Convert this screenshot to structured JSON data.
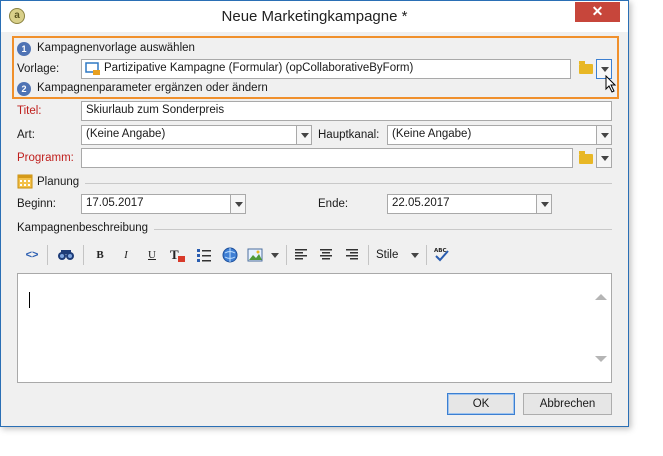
{
  "window": {
    "title": "Neue Marketingkampagne *",
    "close_glyph": "✕",
    "app_icon_glyph": "a"
  },
  "step1": {
    "number": "1",
    "label": "Kampagnenvorlage auswählen",
    "template_label": "Vorlage:",
    "template_value": "Partizipative Kampagne (Formular) (opCollaborativeByForm)"
  },
  "step2": {
    "number": "2",
    "label": "Kampagnenparameter ergänzen oder ändern"
  },
  "form": {
    "title_label": "Titel:",
    "title_value": "Skiurlaub zum Sonderpreis",
    "type_label": "Art:",
    "type_value": "(Keine Angabe)",
    "channel_label": "Hauptkanal:",
    "channel_value": "(Keine Angabe)",
    "program_label": "Programm:",
    "program_value": ""
  },
  "planning": {
    "section_label": "Planung",
    "start_label": "Beginn:",
    "start_value": "17.05.2017",
    "end_label": "Ende:",
    "end_value": "22.05.2017"
  },
  "description": {
    "section_label": "Kampagnenbeschreibung",
    "styles_label": "Stile"
  },
  "toolbar": {
    "source": "<>",
    "find": "⚲",
    "bold": "B",
    "italic": "I",
    "underline": "U",
    "spell": "ABC"
  },
  "buttons": {
    "ok": "OK",
    "cancel": "Abbrechen"
  },
  "colors": {
    "highlight_border": "#f0902c",
    "required_label": "#c0201e",
    "step_circle": "#4f73b4",
    "close_button": "#c7463b"
  }
}
